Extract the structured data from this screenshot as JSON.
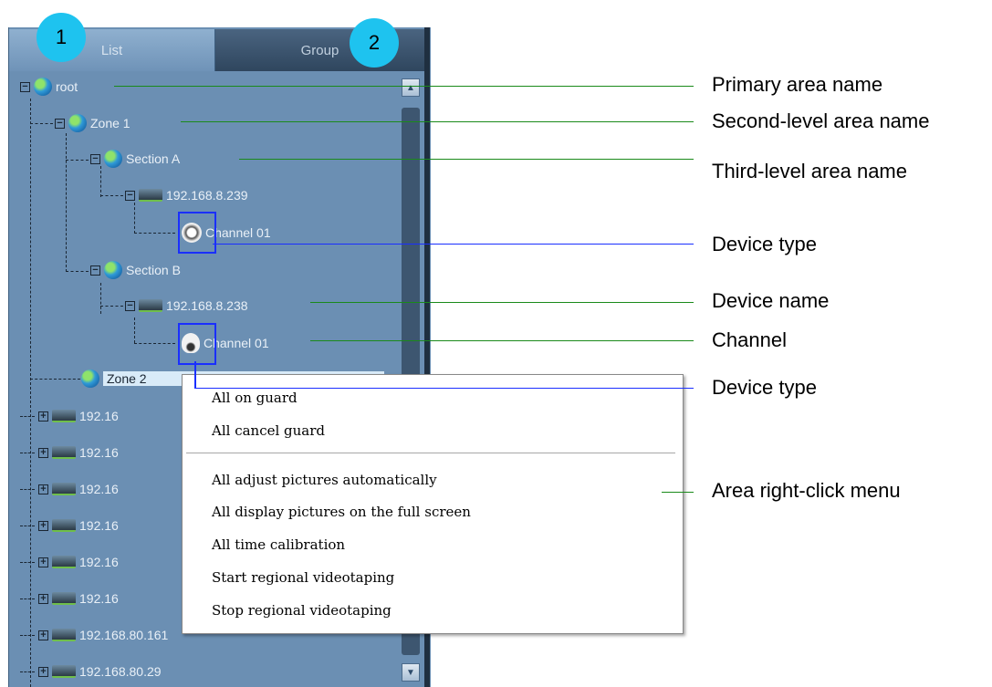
{
  "tabs": [
    {
      "label": "List"
    },
    {
      "label": "Group"
    }
  ],
  "badges": [
    "1",
    "2"
  ],
  "tree": {
    "root": "root",
    "zone1": "Zone 1",
    "section_a": "Section A",
    "device_a": "192.168.8.239",
    "channel_a": "Channel 01",
    "section_b": "Section B",
    "device_b": "192.168.8.238",
    "channel_b": "Channel 01",
    "zone2": "Zone 2",
    "partial_items": [
      "192.16",
      "192.16",
      "192.16",
      "192.16",
      "192.16",
      "192.16",
      "192.168.80.161"
    ],
    "last_item": "192.168.80.29"
  },
  "context_menu": {
    "items_group1": [
      "All on guard",
      "All cancel guard"
    ],
    "items_group2": [
      "All adjust pictures automatically",
      "All display pictures on the full screen",
      "All time calibration",
      "Start regional videotaping",
      "Stop regional videotaping"
    ]
  },
  "annotations": {
    "primary": "Primary area name",
    "second": "Second-level area name",
    "third": "Third-level area name",
    "device_type_1": "Device type",
    "device_name": "Device name",
    "channel": "Channel",
    "device_type_2": "Device type",
    "menu": "Area right-click menu"
  },
  "colors": {
    "panel": "#6b8fb3",
    "badge": "#1ec3ef",
    "annotation_green": "#1a8a1a",
    "annotation_blue": "#1a2fff"
  }
}
